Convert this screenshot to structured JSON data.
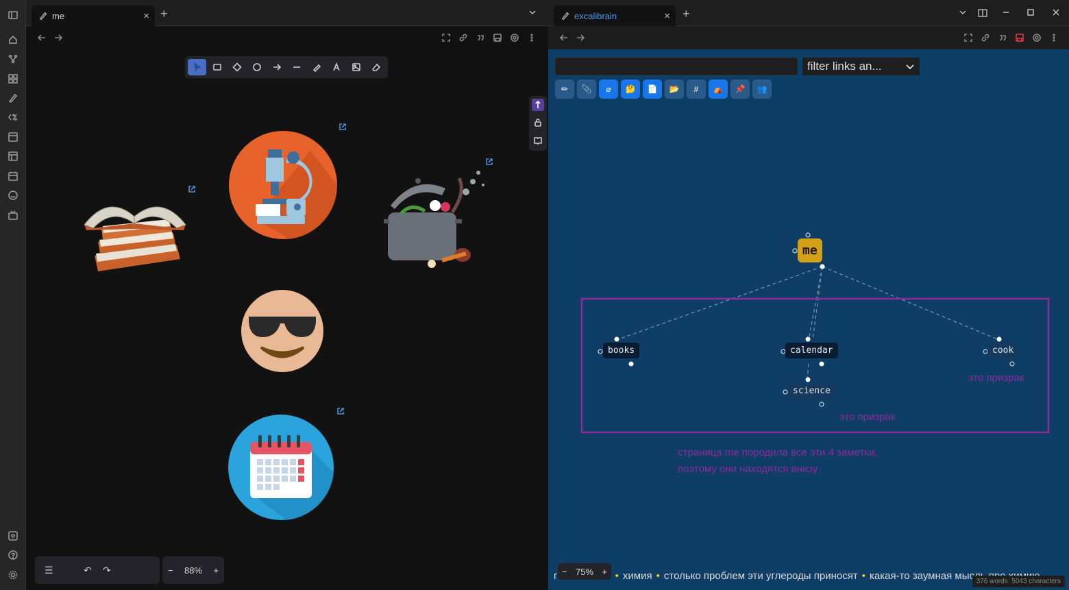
{
  "left_pane": {
    "tab_title": "me",
    "close_glyph": "×",
    "new_tab_glyph": "+",
    "zoom": "88%",
    "zoom_minus": "−",
    "zoom_plus": "+"
  },
  "right_pane": {
    "tab_title": "excalibrain",
    "close_glyph": "×",
    "new_tab_glyph": "+",
    "search_value": "",
    "filter_label": "filter links an...",
    "toolbar_buttons": [
      {
        "glyph": "✏",
        "on": false
      },
      {
        "glyph": "📎",
        "on": false
      },
      {
        "glyph": "⌀",
        "on": true
      },
      {
        "glyph": "🤔",
        "on": true
      },
      {
        "glyph": "📄",
        "on": true
      },
      {
        "glyph": "📂",
        "on": false
      },
      {
        "glyph": "#",
        "on": false
      },
      {
        "glyph": "⛺",
        "on": true
      },
      {
        "glyph": "📌",
        "on": false
      },
      {
        "glyph": "👥",
        "on": false
      }
    ],
    "nodes": {
      "me": "me",
      "books": "books",
      "calendar": "calendar",
      "cook": "cook",
      "science": "science"
    },
    "ghost_labels": {
      "cook_ghost": "это призрак",
      "science_ghost": "это призрак",
      "note_line1": "страница me породила все эти 4 заметки,",
      "note_line2": "поэтому они находятся внизу"
    },
    "ticker": {
      "lead": "г",
      "items": [
        "химия",
        "столько проблем эти углероды приносят",
        "какая-то заумная мысль про химию"
      ]
    },
    "zoom": "75%",
    "zoom_minus": "−",
    "zoom_plus": "+",
    "stats_words": "376 words",
    "stats_chars": "5043 characters"
  },
  "colors": {
    "graph_bg": "#0e3d66",
    "me_node": "#d4a017",
    "ghost_text": "#8e2a9a",
    "selection_rect": "#8e2a9a",
    "active_tool": "#4a6fc0"
  }
}
